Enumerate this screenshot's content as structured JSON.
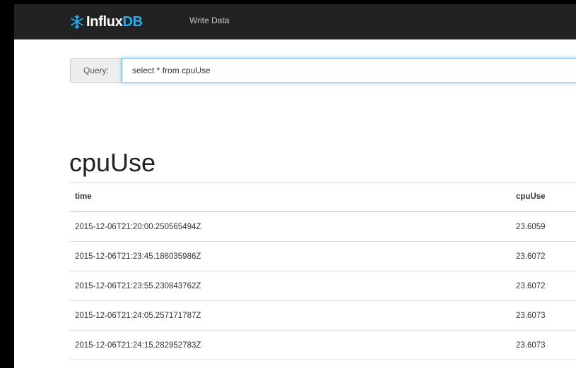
{
  "navbar": {
    "brand_part1": "Influx",
    "brand_part2": "DB",
    "logo_icon": "influxdb-logo-icon",
    "link_write_data": "Write Data",
    "colors": {
      "background": "#222222",
      "brand_accent": "#22adf6"
    }
  },
  "query": {
    "label": "Query:",
    "value": "select * from cpuUse"
  },
  "series": {
    "title": "cpuUse",
    "columns": [
      "time",
      "cpuUse"
    ],
    "rows": [
      {
        "time": "2015-12-06T21:20:00.250565494Z",
        "cpuUse": "23.6059"
      },
      {
        "time": "2015-12-06T21:23:45.186035986Z",
        "cpuUse": "23.6072"
      },
      {
        "time": "2015-12-06T21:23:55.230843762Z",
        "cpuUse": "23.6072"
      },
      {
        "time": "2015-12-06T21:24:05.257171787Z",
        "cpuUse": "23.6073"
      },
      {
        "time": "2015-12-06T21:24:15.282952783Z",
        "cpuUse": "23.6073"
      }
    ]
  }
}
